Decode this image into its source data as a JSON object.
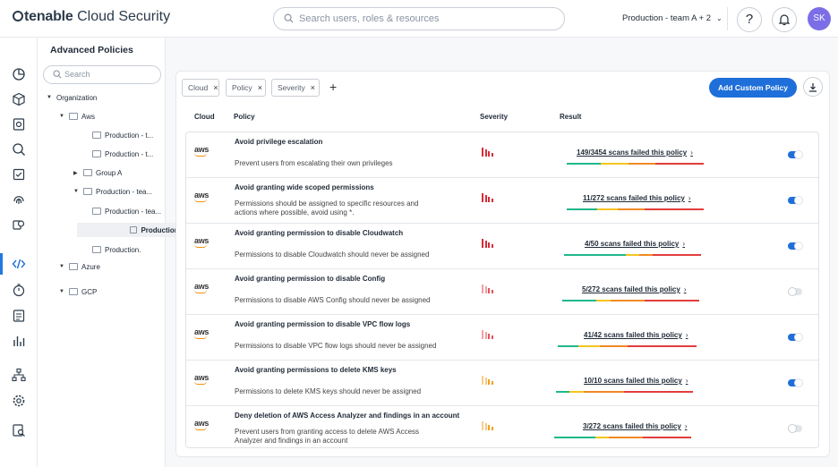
{
  "header": {
    "brand_bold": "tenable",
    "brand_light": "Cloud Security",
    "search_placeholder": "Search users, roles & resources",
    "context": "Production - team A + 2",
    "help_icon": "?",
    "avatar": "SK"
  },
  "rail": {
    "icons": [
      "dashboard-icon",
      "cube-icon",
      "inventory-icon",
      "explore-icon",
      "compliance-icon",
      "fingerprint-icon",
      "findings-icon",
      "code-icon",
      "timer-icon",
      "reports-icon",
      "analytics-icon",
      "org-icon",
      "settings-icon",
      "audit-icon"
    ],
    "active_index": 7
  },
  "tree": {
    "title": "Advanced Policies",
    "search_placeholder": "Search",
    "nodes": [
      {
        "label": "Organization",
        "arrow": "▼",
        "folder": false
      },
      {
        "label": "Aws",
        "arrow": "▼",
        "folder": true
      },
      {
        "label": "Production - t...",
        "arrow": "",
        "folder": true
      },
      {
        "label": "Production - t...",
        "arrow": "",
        "folder": true
      },
      {
        "label": "Group A",
        "arrow": "▶",
        "folder": true
      },
      {
        "label": "Production - tea...",
        "arrow": "▼",
        "folder": true
      },
      {
        "label": "Production - tea...",
        "arrow": "",
        "folder": true
      },
      {
        "label": "Production - tea...",
        "arrow": "",
        "folder": true,
        "selected": true
      },
      {
        "label": "Production.",
        "arrow": "",
        "folder": true
      },
      {
        "label": "Azure",
        "arrow": "▼",
        "folder": true
      },
      {
        "label": "GCP",
        "arrow": "▼",
        "folder": true
      }
    ]
  },
  "filters": {
    "chips": [
      "Cloud",
      "Severity"
    ],
    "chips_all": [
      "Cloud",
      "Policy",
      "Severity"
    ],
    "add": "+",
    "add_custom_policy": "Add Custom Policy"
  },
  "table": {
    "headers": [
      "Cloud",
      "Policy",
      "Severity",
      "Result"
    ],
    "rows": [
      {
        "cloud": "aws",
        "title": "Avoid privilege escalation",
        "desc": "Prevent users from escalating their own privileges",
        "severity": "high",
        "result": "149/3454 scans failed this policy",
        "enabled": true
      },
      {
        "cloud": "aws",
        "title": "Avoid granting wide scoped permissions",
        "desc": "Permissions should be assigned to specific resources and actions where possible, avoid using *.",
        "severity": "high",
        "result": "11/272 scans failed this policy",
        "enabled": true
      },
      {
        "cloud": "aws",
        "title": "Avoid granting permission to disable Cloudwatch",
        "desc": "Permissions to disable Cloudwatch should never be assigned",
        "severity": "high",
        "result": "4/50 scans failed this policy",
        "enabled": true
      },
      {
        "cloud": "aws",
        "title": "Avoid granting permission to disable Config",
        "desc": "Permissions to disable AWS Config should never be assigned",
        "severity": "medium",
        "result": "5/272 scans failed this policy",
        "enabled": false
      },
      {
        "cloud": "aws",
        "title": "Avoid granting permission to disable VPC flow logs",
        "desc": "Permissions to disable VPC flow logs should never be assigned",
        "severity": "medium",
        "result": "41/42 scans failed this policy",
        "enabled": true
      },
      {
        "cloud": "aws",
        "title": "Avoid granting permissions to delete KMS keys",
        "desc": "Permissions to delete KMS keys should never be assigned",
        "severity": "low",
        "result": "10/10 scans failed this policy",
        "enabled": true
      },
      {
        "cloud": "aws",
        "title": "Deny deletion of AWS Access Analyzer and findings in an account",
        "desc": "Prevent users from granting access to delete AWS Access Analyzer and findings in an account",
        "severity": "low",
        "result": "3/272 scans failed this policy",
        "enabled": false
      }
    ]
  },
  "colors": {
    "accent": "#1e6fd9",
    "high": "#d62d3a",
    "medium": "#e5535c",
    "low": "#f0a020",
    "bar_green": "#1fb88a",
    "bar_yellow": "#f4c51f",
    "bar_orange": "#f08a24",
    "bar_red": "#e33d3d"
  }
}
